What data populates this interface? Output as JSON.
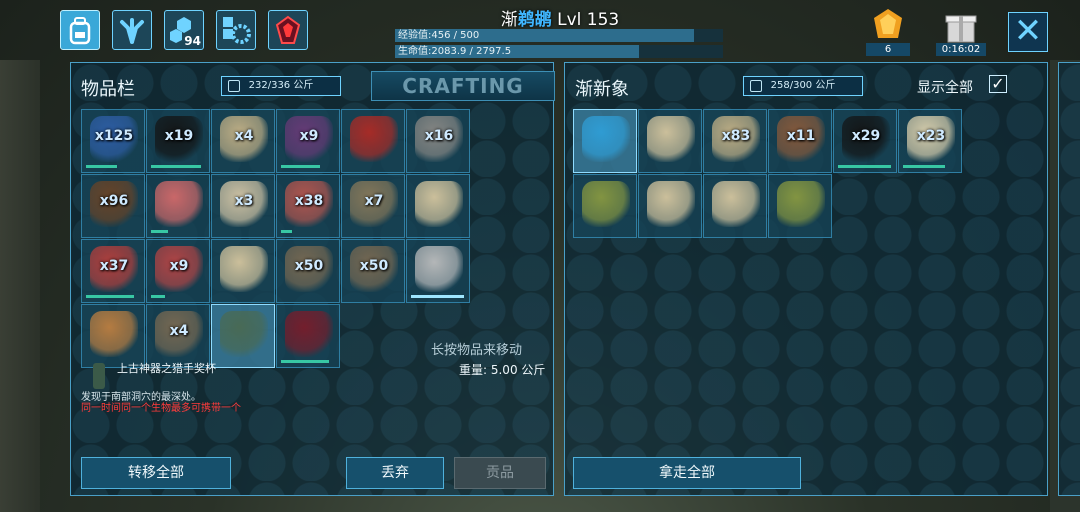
{
  "topbar": {
    "tabs": [
      {
        "icon": "backpack-icon",
        "active": true
      },
      {
        "icon": "dino-footprint-icon"
      },
      {
        "icon": "engrams-icon",
        "count": "94"
      },
      {
        "icon": "settings-gear-icon"
      },
      {
        "icon": "tribe-crystal-icon"
      }
    ],
    "player_prefix": "渐",
    "player_mid": "鹈鹕",
    "player_level": "Lvl 153",
    "xp_text": "经验值:456 / 500",
    "xp_fraction": 0.912,
    "hp_text": "生命值:2083.9 / 2797.5",
    "hp_fraction": 0.745,
    "gem_count": "6",
    "gift_timer": "0:16:02"
  },
  "left": {
    "title": "物品栏",
    "weight": "232/336 公斤",
    "crafting_tab": "CRAFTING",
    "long_press_hint": "长按物品来移动",
    "selected": {
      "name": "上古神器之猎手奖杯",
      "weight": "重量: 5.00 公斤",
      "description": "发现于南部洞穴的最深处。",
      "warning": "同一时间同一个生物最多可携带一个"
    },
    "buttons": {
      "transfer_all": "转移全部",
      "drop": "丢弃",
      "tribute": "贡品"
    },
    "slots": [
      {
        "item": "blue-berries",
        "color": "#2f5fa8",
        "qty": "x125",
        "dur": 0.55
      },
      {
        "item": "narcoberries",
        "color": "#141414",
        "qty": "x19",
        "dur": 0.9
      },
      {
        "item": "fiber",
        "color": "#c7b488",
        "qty": "x4",
        "dur": 0.0
      },
      {
        "item": "mejoberries",
        "color": "#6a3a78",
        "qty": "x9",
        "dur": 0.7
      },
      {
        "item": "raw-meat-pile",
        "color": "#b02a24",
        "qty": "",
        "dur": 0.0
      },
      {
        "item": "stone",
        "color": "#8c8a86",
        "qty": "x16",
        "dur": 0.0
      },
      {
        "item": "wood-bowl",
        "color": "#6b4426",
        "qty": "x96",
        "dur": 0.0
      },
      {
        "item": "raw-prime-meat",
        "color": "#d66a6a",
        "qty": "",
        "dur": 0.3
      },
      {
        "item": "tusk",
        "color": "#d8c9a8",
        "qty": "x3",
        "dur": 0.0
      },
      {
        "item": "cooked-meat",
        "color": "#b8564e",
        "qty": "x38",
        "dur": 0.2
      },
      {
        "item": "spear",
        "color": "#8a7a5a",
        "qty": "x7",
        "dur": 0.0
      },
      {
        "item": "recipe-note-bottle",
        "color": "#d8c8a0",
        "qty": "",
        "dur": 0.0
      },
      {
        "item": "raw-meat",
        "color": "#b83f3c",
        "qty": "x37",
        "dur": 0.85
      },
      {
        "item": "raw-meat-2",
        "color": "#b84444",
        "qty": "x9",
        "dur": 0.25
      },
      {
        "item": "recipe-note-jerky",
        "color": "#d8c8a0",
        "qty": "",
        "dur": 0.0
      },
      {
        "item": "arrow",
        "color": "#7a6a52",
        "qty": "x50",
        "dur": 0.0
      },
      {
        "item": "arrow-2",
        "color": "#7a6a52",
        "qty": "x50",
        "dur": 0.0
      },
      {
        "item": "pike",
        "color": "#bfbfbf",
        "qty": "",
        "dur": 0.95,
        "dur_blue": true
      },
      {
        "item": "recipe-note-soup",
        "color": "#c08040",
        "qty": "",
        "dur": 0.0
      },
      {
        "item": "spear-2",
        "color": "#7a6a52",
        "qty": "x4",
        "dur": 0.0
      },
      {
        "item": "hunter-trophy",
        "color": "#4a6a52",
        "qty": "",
        "dur": 0.0,
        "selected": true
      },
      {
        "item": "dino-egg",
        "color": "#7a1c2a",
        "qty": "",
        "dur": 0.85
      }
    ]
  },
  "right": {
    "title": "渐新象",
    "weight": "258/300 公斤",
    "show_all": "显示全部",
    "checkbox": "✓",
    "buttons": {
      "take_all": "拿走全部"
    },
    "slots": [
      {
        "item": "magnifier",
        "color": "#2f9fd8",
        "qty": "",
        "dur": 0.0,
        "selected": true
      },
      {
        "item": "recipe-note-bottle",
        "color": "#d8c8a0",
        "qty": "",
        "dur": 0.0
      },
      {
        "item": "fiber",
        "color": "#c7b488",
        "qty": "x83",
        "dur": 0.0
      },
      {
        "item": "wood",
        "color": "#8a5a3a",
        "qty": "x11",
        "dur": 0.0
      },
      {
        "item": "narcoberries",
        "color": "#141414",
        "qty": "x29",
        "dur": 0.95
      },
      {
        "item": "seeds",
        "color": "#e0d4b0",
        "qty": "x23",
        "dur": 0.75
      },
      {
        "item": "recipe-note-soup",
        "color": "#8a9a40",
        "qty": "",
        "dur": 0.0
      },
      {
        "item": "recipe-note-jerky",
        "color": "#d8c8a0",
        "qty": "",
        "dur": 0.0
      },
      {
        "item": "recipe-note-bottle-2",
        "color": "#d8c8a0",
        "qty": "",
        "dur": 0.0
      },
      {
        "item": "recipe-note-soup-2",
        "color": "#8a9a40",
        "qty": "",
        "dur": 0.0
      }
    ]
  }
}
